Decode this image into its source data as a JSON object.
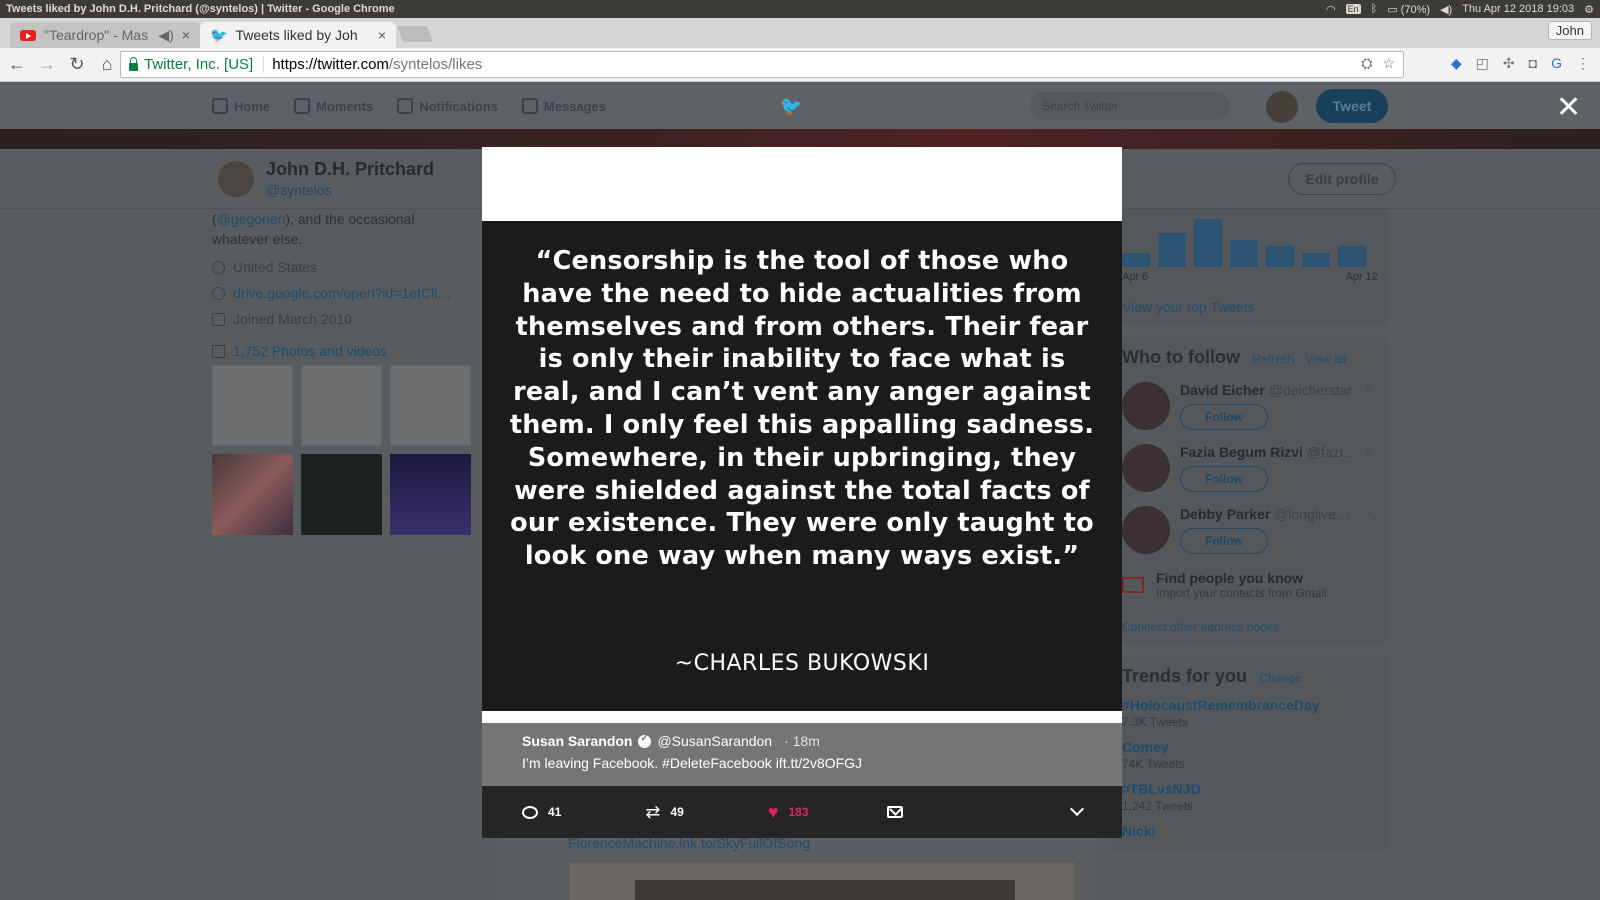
{
  "os": {
    "window_title": "Tweets liked by John D.H. Pritchard (@syntelos) | Twitter - Google Chrome",
    "lang": "En",
    "battery": "(70%)",
    "datetime": "Thu Apr 12 2018 19:03"
  },
  "browser": {
    "tabs": [
      {
        "label": "\"Teardrop\" - Mas",
        "icon": "youtube-icon",
        "active": false
      },
      {
        "label": "Tweets liked by Joh",
        "icon": "twitter-icon",
        "active": true
      }
    ],
    "profile": "John",
    "secure_label": "Twitter, Inc. [US]",
    "url_host": "https://twitter.com",
    "url_path": "/syntelos/likes"
  },
  "twitter_nav": {
    "items": [
      {
        "label": "Home",
        "icon": "home-icon"
      },
      {
        "label": "Moments",
        "icon": "lightning-icon"
      },
      {
        "label": "Notifications",
        "icon": "bell-icon"
      },
      {
        "label": "Messages",
        "icon": "envelope-icon"
      }
    ],
    "search_placeholder": "Search Twitter",
    "tweet_button": "Tweet",
    "close": "✕"
  },
  "profile": {
    "name": "John D.H. Pritchard",
    "handle": "@syntelos",
    "edit_profile": "Edit profile",
    "bio_link": "@gegonen",
    "bio_pre": "(",
    "bio_post": "), and the occasional whatever else.",
    "location": "United States",
    "website": "drive.google.com/open?id=1etCli…",
    "joined": "Joined March 2010",
    "photos": "1,752 Photos and videos"
  },
  "activity": {
    "values": [
      2,
      5,
      7,
      4,
      3,
      2,
      3
    ],
    "label_start": "Apr 6",
    "label_end": "Apr 12",
    "top_tweets": "View your top Tweets"
  },
  "who_to_follow": {
    "title": "Who to follow",
    "refresh": "Refresh",
    "view_all": "View all",
    "follow": "Follow",
    "people": [
      {
        "name": "David Eicher",
        "handle": "@deicherstar"
      },
      {
        "name": "Fazia Begum Rizvi",
        "handle": "@fazi…"
      },
      {
        "name": "Debby Parker",
        "handle": "@longlive…"
      }
    ],
    "find_title": "Find people you know",
    "find_sub": "Import your contacts from Gmail",
    "address_books": "Connect other address books"
  },
  "trends": {
    "title": "Trends for you",
    "change": "Change",
    "items": [
      {
        "name": "#HolocaustRemembranceDay",
        "count": "7.3K Tweets"
      },
      {
        "name": "Comey",
        "count": "74K Tweets"
      },
      {
        "name": "#TBLvsNJD",
        "count": "1,242 Tweets"
      },
      {
        "name": "Nicki",
        "count": ""
      }
    ]
  },
  "behind": {
    "link": "FlorenceMachine.lnk.to/SkyFullOfSong"
  },
  "modal": {
    "quote": "“Censorship is the tool of those who have the need to hide actualities from themselves and from others. Their fear is only their inability to face what is real, and I can’t vent any anger against them. I only feel this appalling sadness. Somewhere, in their upbringing, they were shielded against the total facts of our existence. They were only taught to look one way when many ways exist.”",
    "attribution": "~CHARLES BUKOWSKI",
    "author_name": "Susan Sarandon",
    "author_handle": "@SusanSarandon",
    "time": "· 18m",
    "text": "I’m leaving Facebook. #DeleteFacebook ift.tt/2v8OFGJ",
    "replies": "41",
    "retweets": "49",
    "likes": "183"
  }
}
